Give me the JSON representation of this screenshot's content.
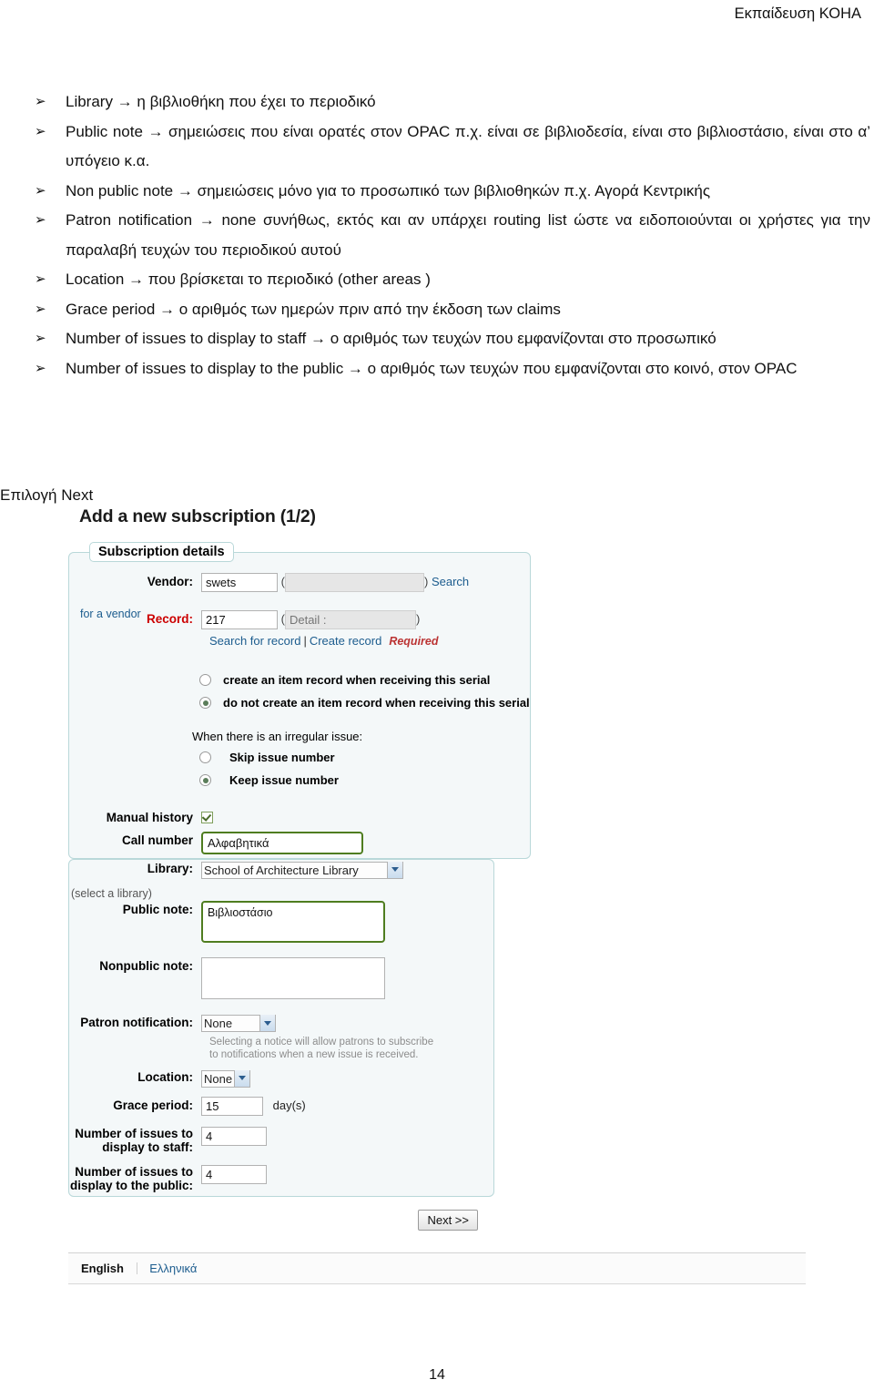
{
  "header": {
    "title": "Εκπαίδευση ΚΟΗΑ"
  },
  "doc": {
    "bullets": [
      {
        "marker": "➢",
        "text": "Library → η βιβλιοθήκη που έχει το περιοδικό"
      },
      {
        "marker": "➢",
        "text": "Public note → σημειώσεις που είναι ορατές στον OPAC π.χ. είναι σε βιβλιοδεσία, είναι στο βιβλιοστάσιο, είναι στο α’ υπόγειο κ.α."
      },
      {
        "marker": "➢",
        "text": "Non public note → σημειώσεις μόνο για το προσωπικό των βιβλιοθηκών π.χ. Αγορά Κεντρικής"
      },
      {
        "marker": "➢",
        "text": "Patron notification → none συνήθως, εκτός και αν υπάρχει routing list ώστε να ειδοποιούνται οι χρήστες για την παραλαβή τευχών του περιοδικού αυτού"
      },
      {
        "marker": "➢",
        "text": "Location → που βρίσκεται το περιοδικό (other areas )"
      },
      {
        "marker": "➢",
        "text": "Grace period → ο αριθμός των ημερών πριν από την έκδοση των claims"
      },
      {
        "marker": "➢",
        "text": "Number of issues to display to staff → ο αριθμός των τευχών που εμφανίζονται στο προσωπικό"
      },
      {
        "marker": "➢",
        "text": "Number of issues to display to the public → ο αριθμός των τευχών που εμφανίζονται στο κοινό, στον OPAC"
      }
    ],
    "next_instruction": "Επιλογή Next",
    "page_number": "14"
  },
  "screenshot": {
    "title": "Add a new subscription (1/2)",
    "fieldset1": {
      "legend": "Subscription details",
      "vendor_label": "Vendor:",
      "vendor_value": "swets",
      "vendor_detail_value": "",
      "vendor_search_link": "Search",
      "vendor_hint": "for a vendor",
      "record_label": "Record:",
      "record_value": "217",
      "record_detail_placeholder": "Detail :",
      "record_search_link": "Search for record",
      "record_create_link": "Create record",
      "record_required": "Required",
      "paren_open": "(",
      "paren_close": ")",
      "sep": "|",
      "radio_create_item": "create an item record when receiving this serial",
      "radio_no_create_item": "do not create an item record when receiving this serial",
      "radio_item_selected": "do not create an item record when receiving this serial",
      "irregular_title": "When there is an irregular issue:",
      "radio_skip": "Skip issue number",
      "radio_keep": "Keep issue number",
      "radio_irregular_selected": "Keep issue number",
      "manual_history_label": "Manual history",
      "manual_history_checked": "true",
      "call_number_label": "Call number",
      "call_number_value": "Αλφαβητικά"
    },
    "fieldset2": {
      "library_label": "Library:",
      "library_value": "School of Architecture Library",
      "library_hint": "(select a library)",
      "public_note_label": "Public note:",
      "public_note_value": "Βιβλιοστάσιο",
      "nonpublic_note_label": "Nonpublic note:",
      "nonpublic_note_value": "",
      "patron_notification_label": "Patron notification:",
      "patron_notification_value": "None",
      "patron_notification_hint": "Selecting a notice will allow patrons to subscribe to notifications when a new issue is received.",
      "location_label": "Location:",
      "location_value": "None",
      "grace_period_label": "Grace period:",
      "grace_period_value": "15",
      "grace_period_unit": "day(s)",
      "issues_staff_label": "Number of issues to display to staff:",
      "issues_staff_value": "4",
      "issues_public_label": "Number of issues to display to the public:",
      "issues_public_value": "4"
    },
    "next_button": "Next >>",
    "lang_bar": {
      "english": "English",
      "greek": "Ελληνικά"
    }
  }
}
